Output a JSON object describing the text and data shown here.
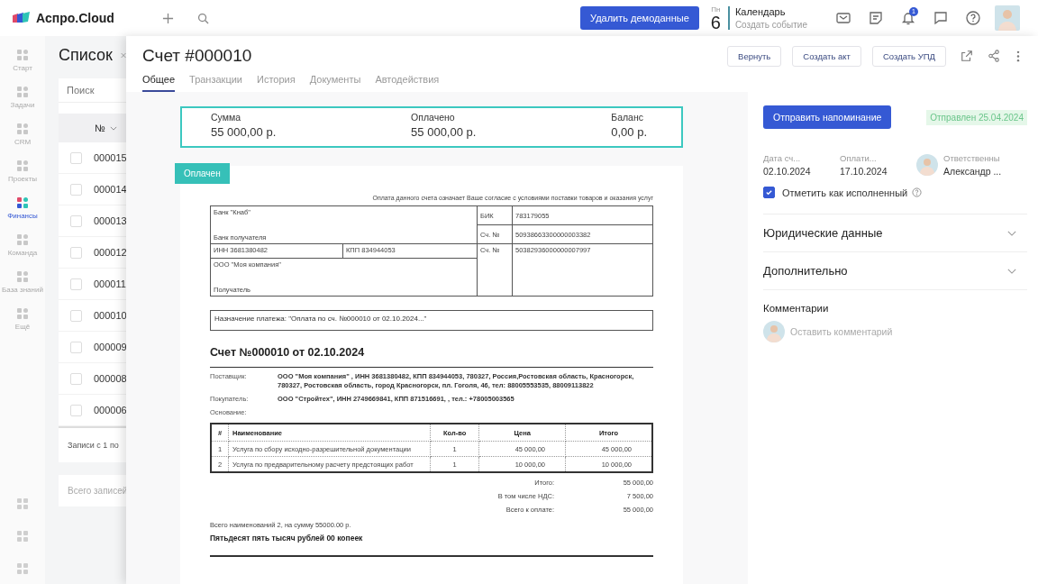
{
  "topbar": {
    "logo": "Аспро.Cloud",
    "demo_button": "Удалить демоданные",
    "date": {
      "weekday": "Пн",
      "day": "6"
    },
    "calendar": {
      "title": "Календарь",
      "action": "Создать событие"
    },
    "notifications_badge": "1"
  },
  "nav": [
    {
      "label": "Старт",
      "selected": false
    },
    {
      "label": "Задачи",
      "selected": false
    },
    {
      "label": "CRM",
      "selected": false
    },
    {
      "label": "Проекты",
      "selected": false
    },
    {
      "label": "Финансы",
      "selected": true
    },
    {
      "label": "Команда",
      "selected": false
    },
    {
      "label": "База знаний",
      "selected": false
    },
    {
      "label": "Ещё",
      "selected": false
    }
  ],
  "list": {
    "title": "Список",
    "search_placeholder": "Поиск",
    "column": "№",
    "rows": [
      {
        "number": "000015",
        "checked": false
      },
      {
        "number": "000014",
        "checked": false
      },
      {
        "number": "000013",
        "checked": false
      },
      {
        "number": "000012",
        "checked": false
      },
      {
        "number": "000011",
        "checked": false
      },
      {
        "number": "000010",
        "checked": false
      },
      {
        "number": "000009",
        "checked": false
      },
      {
        "number": "000008",
        "checked": false
      },
      {
        "number": "000006",
        "checked": false
      }
    ],
    "footer": "Записи с 1 по",
    "total": "Всего записей"
  },
  "invoice": {
    "title": "Счет #000010",
    "tabs": [
      {
        "label": "Общее",
        "selected": true
      },
      {
        "label": "Транзакции",
        "selected": false
      },
      {
        "label": "История",
        "selected": false
      },
      {
        "label": "Документы",
        "selected": false
      },
      {
        "label": "Автодействия",
        "selected": false
      }
    ],
    "actions": [
      "Вернуть",
      "Создать акт",
      "Создать УПД"
    ],
    "summary": [
      {
        "label": "Сумма",
        "value": "55 000,00 р."
      },
      {
        "label": "Оплачено",
        "value": "55 000,00 р."
      },
      {
        "label": "Баланс",
        "value": "0,00 р."
      }
    ],
    "status": "Оплачен",
    "document": {
      "notice": "Оплата данного счета означает Ваше согласие с условиями поставки товаров и оказания услуг",
      "bank": {
        "name": "Банк \"Кнаб\"",
        "bank_label": "Банк получателя",
        "inn": "ИНН 3681380482",
        "kpp": "КПП 834944053",
        "recipient": "ООО \"Моя компания\"",
        "recipient_label": "Получатель",
        "bik_label": "БИК",
        "bik": "783179055",
        "corr_label": "Сч. №",
        "corr_account": "50938663300000003382",
        "account_label": "Сч. №",
        "account": "50382936000000007997"
      },
      "purpose": "Назначение платежа: \"Оплата по сч. №000010 от 02.10.2024...\"",
      "heading": "Счет №000010 от 02.10.2024",
      "parties": [
        {
          "label": "Поставщик:",
          "value": "ООО \"Моя компания\" , ИНН 3681380482, КПП 834944053, 780327, Россия,Ростовская область, Красногорск, 780327, Ростовская область, город Красногорск, пл. Гоголя, 46, тел: 88005553535, 88009113822"
        },
        {
          "label": "Покупатель:",
          "value": "ООО \"Стройтех\", ИНН 2749669841, КПП 871516691, , тел.: +78005003565"
        },
        {
          "label": "Основание:"
        }
      ],
      "items": {
        "columns": [
          "#",
          "Наименование",
          "Кол-во",
          "Цена",
          "Итого"
        ],
        "rows": [
          [
            "1",
            "Услуга по сбору исходно-разрешительной документации",
            "1",
            "45 000,00",
            "45 000,00"
          ],
          [
            "2",
            "Услуга по предварительному расчету предстоящих работ",
            "1",
            "10 000,00",
            "10 000,00"
          ]
        ]
      },
      "totals": [
        {
          "label": "Итого:",
          "value": "55 000,00"
        },
        {
          "label": "В том числе НДС:",
          "value": "7 500,00"
        },
        {
          "label": "Всего к оплате:",
          "value": "55 000,00"
        }
      ],
      "count_line": "Всего наименований 2, на сумму 55000.00 р.",
      "amount_words": "Пятьдесят пять тысяч рублей 00 копеек"
    }
  },
  "details": {
    "reminder_button": "Отправить напоминание",
    "sent_badge": "Отправлен 25.04.2024",
    "fields": [
      {
        "kind": "text",
        "label": "Дата сч...",
        "value": "02.10.2024"
      },
      {
        "kind": "text",
        "label": "Оплати...",
        "value": "17.10.2024"
      },
      {
        "kind": "person",
        "label": "Ответственны",
        "value": "Александр ..."
      }
    ],
    "done": {
      "label": "Отметить как исполненный",
      "checked": true
    },
    "sections": [
      {
        "title": "Юридические данные",
        "expanded": false
      },
      {
        "title": "Дополнительно",
        "expanded": false
      }
    ],
    "comments": {
      "title": "Комментарии",
      "placeholder": "Оставить комментарий"
    }
  }
}
